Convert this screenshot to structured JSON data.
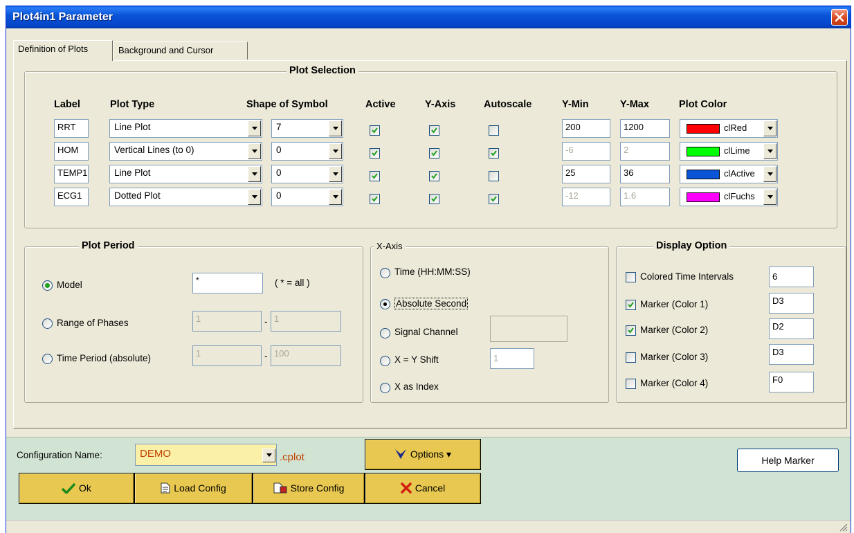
{
  "window": {
    "title": "Plot4in1  Parameter"
  },
  "tabs": [
    {
      "label": "Definition of Plots"
    },
    {
      "label": "Background and Cursor"
    }
  ],
  "plot_selection": {
    "title": "Plot Selection",
    "headers": {
      "label": "Label",
      "plot_type": "Plot Type",
      "shape": "Shape of Symbol",
      "active": "Active",
      "y_axis": "Y-Axis",
      "autoscale": "Autoscale",
      "y_min": "Y-Min",
      "y_max": "Y-Max",
      "plot_color": "Plot Color"
    },
    "rows": [
      {
        "label": "RRT",
        "plot_type": "Line Plot",
        "shape": "7",
        "active": true,
        "y_axis": true,
        "autoscale": false,
        "y_min": "200",
        "y_max": "1200",
        "color_name": "clRed",
        "color": "#ff0000"
      },
      {
        "label": "HOM",
        "plot_type": "Vertical Lines (to 0)",
        "shape": "0",
        "active": true,
        "y_axis": true,
        "autoscale": true,
        "y_min": "-6",
        "y_max": "2",
        "color_name": "clLime",
        "color": "#00ff00"
      },
      {
        "label": "TEMP1",
        "plot_type": "Line Plot",
        "shape": "0",
        "active": true,
        "y_axis": true,
        "autoscale": false,
        "y_min": "25",
        "y_max": "36",
        "color_name": "clActive",
        "color": "#0a54d8"
      },
      {
        "label": "ECG1",
        "plot_type": "Dotted Plot",
        "shape": "0",
        "active": true,
        "y_axis": true,
        "autoscale": true,
        "y_min": "-12",
        "y_max": "1.6",
        "color_name": "clFuchs",
        "color": "#ff00ff"
      }
    ]
  },
  "plot_period": {
    "title": "Plot Period",
    "model_label": "Model",
    "model_value": "*",
    "model_hint": "( * = all )",
    "range_label": "Range of Phases",
    "range_from": "1",
    "range_to": "1",
    "time_label": "Time Period (absolute)",
    "time_from": "1",
    "time_to": "100",
    "separator": "-"
  },
  "x_axis": {
    "title": "X-Axis",
    "time_label": "Time (HH:MM:SS)",
    "abs_label": "Absolute Second",
    "signal_label": "Signal Channel",
    "signal_value": "",
    "shift_label": "X = Y Shift",
    "shift_value": "1",
    "index_label": "X as Index"
  },
  "display_option": {
    "title": "Display Option",
    "items": [
      {
        "label": "Colored Time Intervals",
        "checked": false,
        "value": "6"
      },
      {
        "label": "Marker (Color 1)",
        "checked": true,
        "value": "D3"
      },
      {
        "label": "Marker (Color 2)",
        "checked": true,
        "value": "D2"
      },
      {
        "label": "Marker (Color 3)",
        "checked": false,
        "value": "D3"
      },
      {
        "label": "Marker (Color 4)",
        "checked": false,
        "value": "F0"
      }
    ]
  },
  "config": {
    "name_label": "Configuration Name:",
    "name_value": "DEMO",
    "ext": ".cplot"
  },
  "buttons": {
    "ok": "Ok",
    "load": "Load Config",
    "store": "Store Config",
    "options": "Options",
    "cancel": "Cancel",
    "help": "Help Marker"
  },
  "colors": {
    "accent_bottom": "#d1e4d3",
    "button_yellow": "#e8c850",
    "title_blue": "#0a54d8"
  }
}
